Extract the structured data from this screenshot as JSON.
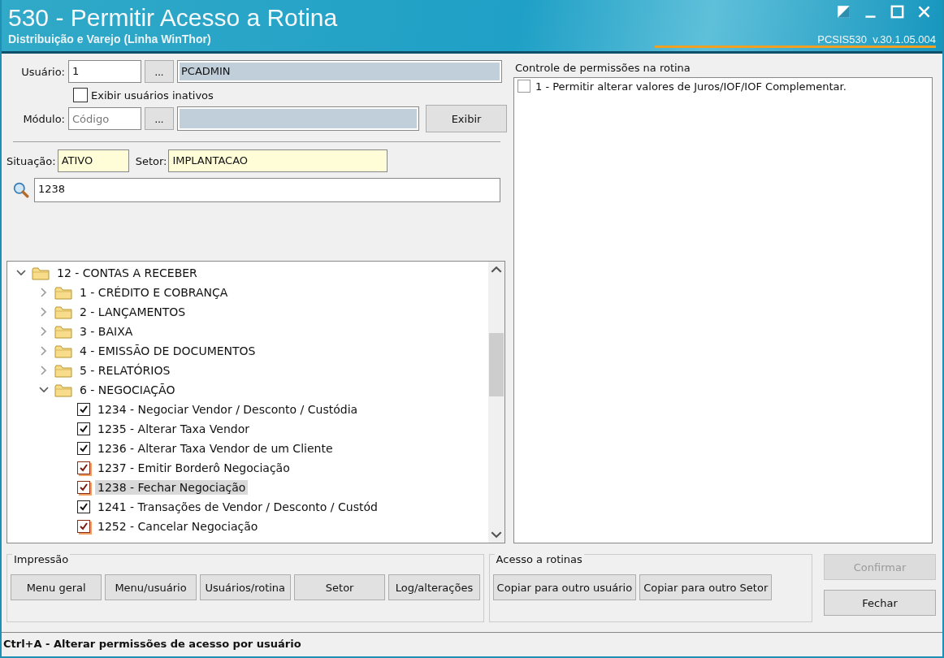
{
  "window": {
    "title": "530 - Permitir Acesso a Rotina",
    "subtitle": "Distribuição e Varejo (Linha WinThor)",
    "version": "PCSIS530  v.30.1.05.004"
  },
  "user_form": {
    "usuario_label": "Usuário:",
    "usuario_code": "1",
    "lookup_button": "...",
    "usuario_name": "PCADMIN",
    "inactive_checkbox": {
      "label": "Exibir usuários inativos",
      "checked": false
    },
    "modulo_label": "Módulo:",
    "modulo_placeholder": "Código",
    "modulo_lookup_button": "...",
    "exibir_button": "Exibir",
    "situacao_label": "Situação:",
    "situacao_value": "ATIVO",
    "setor_label": "Setor:",
    "setor_value": "IMPLANTACAO",
    "search_value": "1238"
  },
  "tree": [
    {
      "kind": "folder",
      "label": "12 - CONTAS A RECEBER",
      "expanded": true,
      "children": [
        {
          "kind": "folder",
          "label": "1 - CRÉDITO E COBRANÇA",
          "expanded": false
        },
        {
          "kind": "folder",
          "label": "2 - LANÇAMENTOS",
          "expanded": false
        },
        {
          "kind": "folder",
          "label": "3 - BAIXA",
          "expanded": false
        },
        {
          "kind": "folder",
          "label": "4 - EMISSÃO DE DOCUMENTOS",
          "expanded": false
        },
        {
          "kind": "folder",
          "label": "5 - RELATÓRIOS",
          "expanded": false
        },
        {
          "kind": "folder",
          "label": "6 - NEGOCIAÇÃO",
          "expanded": true,
          "children": [
            {
              "kind": "routine",
              "label": "1234 - Negociar Vendor / Desconto / Custódia",
              "checked": true,
              "changed": false,
              "selected": false
            },
            {
              "kind": "routine",
              "label": "1235 - Alterar Taxa Vendor",
              "checked": true,
              "changed": false,
              "selected": false
            },
            {
              "kind": "routine",
              "label": "1236 - Alterar Taxa Vendor de um Cliente",
              "checked": true,
              "changed": false,
              "selected": false
            },
            {
              "kind": "routine",
              "label": "1237 - Emitir Borderô Negociação",
              "checked": true,
              "changed": true,
              "selected": false
            },
            {
              "kind": "routine",
              "label": "1238 - Fechar Negociação",
              "checked": true,
              "changed": true,
              "selected": true
            },
            {
              "kind": "routine",
              "label": "1241 - Transações de Vendor / Desconto / Custód",
              "checked": true,
              "changed": false,
              "selected": false
            },
            {
              "kind": "routine",
              "label": "1252 - Cancelar Negociação",
              "checked": true,
              "changed": true,
              "selected": false
            }
          ]
        }
      ]
    }
  ],
  "permissions": {
    "title": "Controle de permissões na rotina",
    "items": [
      {
        "label": "1 - Permitir alterar valores de Juros/IOF/IOF Complementar.",
        "checked": false
      }
    ]
  },
  "print_group": {
    "title": "Impressão",
    "buttons": [
      "Menu geral",
      "Menu/usuário",
      "Usuários/rotina",
      "Setor",
      "Log/alterações"
    ]
  },
  "access_group": {
    "title": "Acesso a rotinas",
    "buttons": [
      "Copiar para outro usuário",
      "Copiar para outro Setor"
    ]
  },
  "actions": [
    {
      "label": "Confirmar",
      "disabled": true
    },
    {
      "label": "Fechar",
      "disabled": false
    }
  ],
  "status_bar": "Ctrl+A - Alterar permissões de acesso por usuário"
}
